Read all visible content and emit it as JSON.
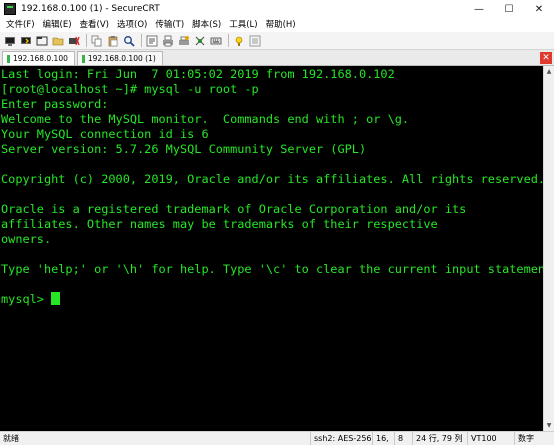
{
  "window": {
    "title": "192.168.0.100 (1) - SecureCRT",
    "minimize_glyph": "—",
    "maximize_glyph": "☐",
    "close_glyph": "✕"
  },
  "menu": [
    {
      "label": "文件(F)"
    },
    {
      "label": "编辑(E)"
    },
    {
      "label": "查看(V)"
    },
    {
      "label": "选项(O)"
    },
    {
      "label": "传输(T)"
    },
    {
      "label": "脚本(S)"
    },
    {
      "label": "工具(L)"
    },
    {
      "label": "帮助(H)"
    }
  ],
  "toolbar": {
    "buttons": [
      {
        "icon": "connect-icon"
      },
      {
        "icon": "quick-connect-icon"
      },
      {
        "icon": "connect-tab-icon"
      },
      {
        "icon": "session-folder-icon"
      },
      {
        "icon": "disconnect-icon"
      },
      {
        "icon": "copy-icon"
      },
      {
        "icon": "paste-icon"
      },
      {
        "icon": "find-icon"
      },
      {
        "icon": "session-options-icon"
      },
      {
        "icon": "print-icon"
      },
      {
        "icon": "printer-setup-icon"
      },
      {
        "icon": "sftp-icon"
      },
      {
        "icon": "keymap-icon"
      },
      {
        "icon": "help-icon"
      },
      {
        "icon": "toggle-icon"
      }
    ]
  },
  "tabs": [
    {
      "label": "192.168.0.100",
      "active": true
    },
    {
      "label": "192.168.0.100 (1)",
      "active": false
    }
  ],
  "terminal": {
    "lines": [
      "Last login: Fri Jun  7 01:05:02 2019 from 192.168.0.102",
      "[root@localhost ~]# mysql -u root -p",
      "Enter password:",
      "Welcome to the MySQL monitor.  Commands end with ; or \\g.",
      "Your MySQL connection id is 6",
      "Server version: 5.7.26 MySQL Community Server (GPL)",
      "",
      "Copyright (c) 2000, 2019, Oracle and/or its affiliates. All rights reserved.",
      "",
      "Oracle is a registered trademark of Oracle Corporation and/or its",
      "affiliates. Other names may be trademarks of their respective",
      "owners.",
      "",
      "Type 'help;' or '\\h' for help. Type '\\c' to clear the current input statement.",
      "",
      "mysql> "
    ],
    "text_color": "#26e626",
    "background": "#000000"
  },
  "status": {
    "ready": "就绪",
    "cipher": "ssh2: AES-256",
    "row": "16,",
    "col": "8",
    "size": "24 行, 79 列",
    "terminal_type": "VT100",
    "numlock": "数字"
  }
}
